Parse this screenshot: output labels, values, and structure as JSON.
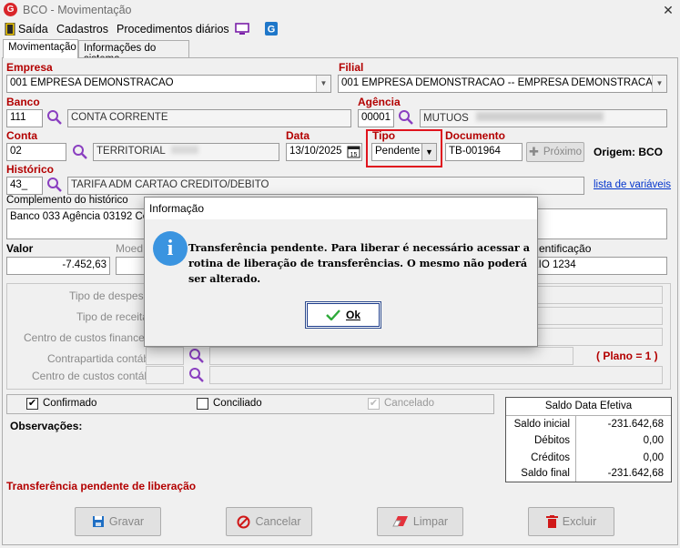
{
  "window": {
    "title": "BCO - Movimentação"
  },
  "menu": {
    "saida": "Saída",
    "cadastros": "Cadastros",
    "procedimentos": "Procedimentos diários"
  },
  "tabs": [
    "Movimentação",
    "Informações do sistema"
  ],
  "form": {
    "empresa_label": "Empresa",
    "empresa_value": "001 EMPRESA DEMONSTRACAO",
    "filial_label": "Filial",
    "filial_value": "001 EMPRESA DEMONSTRACAO -- EMPRESA DEMONSTRACAO",
    "banco_label": "Banco",
    "banco_code": "111",
    "banco_name": "CONTA CORRENTE",
    "agencia_label": "Agência",
    "agencia_code": "00001",
    "agencia_name": "MUTUOS",
    "conta_label": "Conta",
    "conta_code": "02",
    "conta_name": "TERRITORIAL",
    "data_label": "Data",
    "data_value": "13/10/2025",
    "tipo_label": "Tipo",
    "tipo_value": "Pendente",
    "documento_label": "Documento",
    "documento_value": "TB-001964",
    "proximo_label": "Próximo",
    "origem_label": "Origem: BCO",
    "historico_label": "Histórico",
    "historico_code": "43_",
    "historico_name": "TARIFA ADM CARTAO CREDITO/DEBITO",
    "lista_link": "lista de variáveis",
    "complemento_label": "Complemento do histórico",
    "complemento_value": "Banco 033 Agência 03192 Con",
    "valor_label": "Valor",
    "valor_value": "-7.452,63",
    "moeda_label": "Moed",
    "ident_label": "entificação",
    "ident_value": "XIO 1234",
    "tipo_despesa": "Tipo de despesa",
    "tipo_receita": "Tipo de receita",
    "centro_financeiro": "Centro de custos financeiro",
    "contrapartida": "Contrapartida contábil",
    "centro_contabil": "Centro de custos contábil",
    "plano": "( Plano = 1 )"
  },
  "status": {
    "confirmado": "Confirmado",
    "conciliado": "Conciliado",
    "cancelado": "Cancelado",
    "observacoes": "Observações:",
    "pendente_msg": "Transferência pendente de liberação"
  },
  "saldo": {
    "title": "Saldo Data Efetiva",
    "rows": [
      {
        "label": "Saldo inicial",
        "value": "-231.642,68"
      },
      {
        "label": "Débitos",
        "value": "0,00"
      },
      {
        "label": "Créditos",
        "value": "0,00"
      },
      {
        "label": "Saldo final",
        "value": "-231.642,68"
      }
    ]
  },
  "buttons": {
    "gravar": "Gravar",
    "cancelar": "Cancelar",
    "limpar": "Limpar",
    "excluir": "Excluir"
  },
  "dialog": {
    "title": "Informação",
    "message": "Transferência pendente. Para liberar é necessário acessar a rotina de liberação de transferências. O mesmo não poderá ser alterado.",
    "ok": "Ok"
  },
  "colors": {
    "accent_red": "#b30000",
    "highlight_box": "#e0141e",
    "link": "#0033cc",
    "info_blue": "#3a94e0"
  }
}
